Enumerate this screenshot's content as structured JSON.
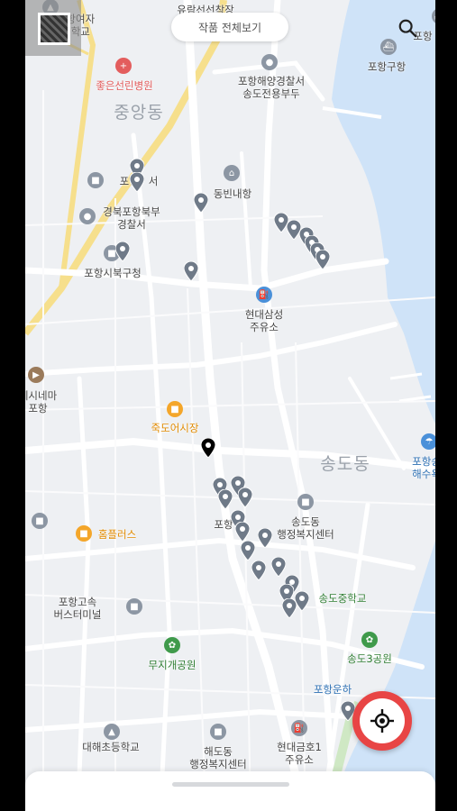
{
  "top_button": {
    "label": "작품 전체보기"
  },
  "districts": [
    {
      "name": "중앙동"
    },
    {
      "name": "송도동"
    }
  ],
  "labels": [
    {
      "text": "포항여자\n동학교",
      "kind": "plain"
    },
    {
      "text": "유람선선착장",
      "kind": "plain"
    },
    {
      "text": "포항구항",
      "kind": "plain"
    },
    {
      "text": "포항",
      "kind": "plain"
    },
    {
      "text": "좋은선린병원",
      "kind": "hosp"
    },
    {
      "text": "포항해양경찰서\n송도전용부두",
      "kind": "plain"
    },
    {
      "text": "포항   서",
      "kind": "plain"
    },
    {
      "text": "동빈내항",
      "kind": "plain"
    },
    {
      "text": "경북포항북부\n경찰서",
      "kind": "plain"
    },
    {
      "text": "포항시북구청",
      "kind": "plain"
    },
    {
      "text": "현대삼성\n주유소",
      "kind": "plain"
    },
    {
      "text": "메시네마\n포항",
      "kind": "plain"
    },
    {
      "text": "죽도어시장",
      "kind": "mkt"
    },
    {
      "text": "포항송\n해수욕",
      "kind": "blue"
    },
    {
      "text": "송도동\n행정복지센터",
      "kind": "plain"
    },
    {
      "text": "포항",
      "kind": "plain"
    },
    {
      "text": "홈플러스",
      "kind": "mkt"
    },
    {
      "text": "송도중학교",
      "kind": "park"
    },
    {
      "text": "포항고속\n버스터미널",
      "kind": "plain"
    },
    {
      "text": "무지개공원",
      "kind": "park"
    },
    {
      "text": "송도3공원",
      "kind": "park"
    },
    {
      "text": "포항운하",
      "kind": "blue"
    },
    {
      "text": "대해초등학교",
      "kind": "plain"
    },
    {
      "text": "해도동\n행정복지센터",
      "kind": "plain"
    },
    {
      "text": "현대금호1\n주유소",
      "kind": "plain"
    }
  ],
  "icons": {
    "search": "search-icon",
    "locate": "crosshair-icon",
    "qr": "qr-code-icon"
  },
  "colors": {
    "land": "#eef0f3",
    "water": "#cfe3f8",
    "road": "#ffffff",
    "major_road": "#f6df8c",
    "pin": "#6f7a88",
    "pin_selected": "#000000",
    "locate_ring": "#e84545"
  }
}
